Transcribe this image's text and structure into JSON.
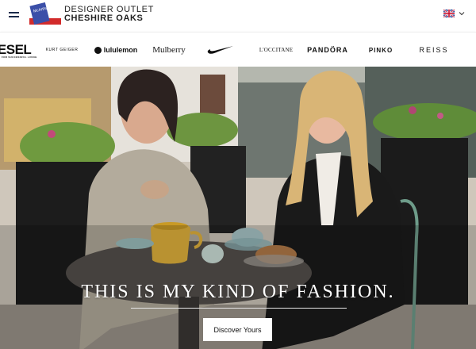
{
  "header": {
    "menu_icon": "hamburger-icon",
    "logo_text": "McArthur Glen",
    "brand_line1": "DESIGNER OUTLET",
    "brand_line2": "CHESHIRE OAKS",
    "language_flag_icon": "uk-flag-icon",
    "language_chevron_icon": "chevron-down-icon"
  },
  "brand_strip": {
    "items": [
      {
        "label": "IESEL",
        "sublabel": "FOR SUCCESSFUL LIVING"
      },
      {
        "label": "KURT GEIGER"
      },
      {
        "label": "lululemon"
      },
      {
        "label": "Mulberry"
      },
      {
        "label": "Nike",
        "icon": "nike-swoosh-icon"
      },
      {
        "label": "L'OCCITANE"
      },
      {
        "label": "PANDÖRA"
      },
      {
        "label": "PINKO"
      },
      {
        "label": "REISS"
      }
    ]
  },
  "hero": {
    "headline": "THIS IS MY KIND OF FASHION.",
    "cta_label": "Discover Yours"
  },
  "colors": {
    "brand_navy": "#1a2a4a",
    "logo_blue": "#3b4fa8",
    "logo_red": "#d22b2b",
    "headline": "#ffffff",
    "cta_background": "#ffffff"
  }
}
